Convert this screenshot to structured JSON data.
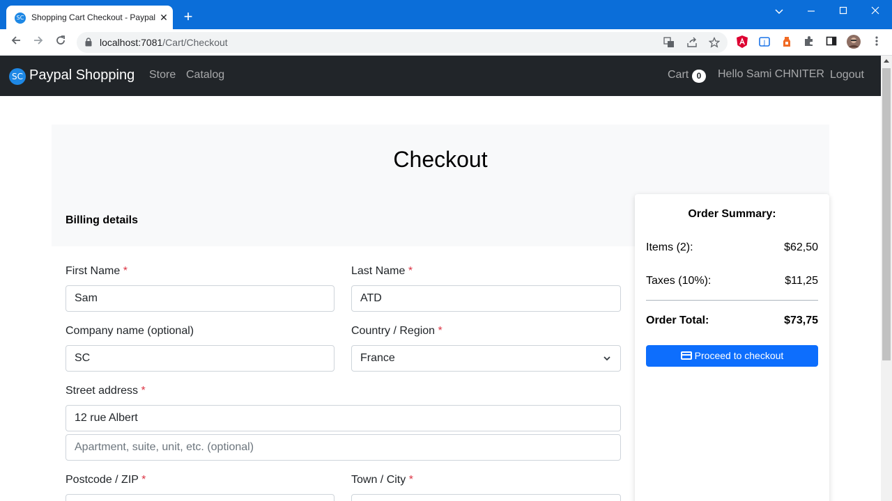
{
  "browser": {
    "tab_title": "Shopping Cart Checkout - Paypal Shopping",
    "tab_favicon": "SC",
    "url_host": "localhost:7081",
    "url_path": "/Cart/Checkout",
    "new_tab": "+",
    "close_tab": "✕"
  },
  "navbar": {
    "logo_text": "SC",
    "brand": "Paypal Shopping",
    "links": [
      "Store",
      "Catalog"
    ],
    "cart_label": "Cart",
    "cart_count": "0",
    "greeting": "Hello Sami CHNITER",
    "logout": "Logout"
  },
  "checkout": {
    "title": "Checkout",
    "billing_title": "Billing details",
    "first_name_label": "First Name",
    "first_name_value": "Sam",
    "last_name_label": "Last Name",
    "last_name_value": "ATD",
    "company_label": "Company name (optional)",
    "company_value": "SC",
    "country_label": "Country / Region",
    "country_value": "France",
    "street_label": "Street address",
    "street_value": "12 rue Albert",
    "apt_placeholder": "Apartment, suite, unit, etc. (optional)",
    "postcode_label": "Postcode / ZIP",
    "town_label": "Town / City",
    "required_mark": "*"
  },
  "summary": {
    "title": "Order Summary:",
    "items_label": "Items (2):",
    "items_value": "$62,50",
    "taxes_label": "Taxes (10%):",
    "taxes_value": "$11,25",
    "total_label": "Order Total:",
    "total_value": "$73,75",
    "button_label": "Proceed to checkout"
  },
  "colors": {
    "titlebar": "#0b6ed9",
    "navbar": "#212529",
    "primary": "#0d6efd",
    "required": "#dc3545"
  },
  "icons": [
    "back-icon",
    "forward-icon",
    "reload-icon",
    "lock-icon",
    "translate-icon",
    "share-icon",
    "star-icon",
    "extension-icon",
    "sidebar-icon",
    "profile-avatar",
    "menu-icon",
    "chevron-down-icon",
    "credit-card-icon"
  ]
}
